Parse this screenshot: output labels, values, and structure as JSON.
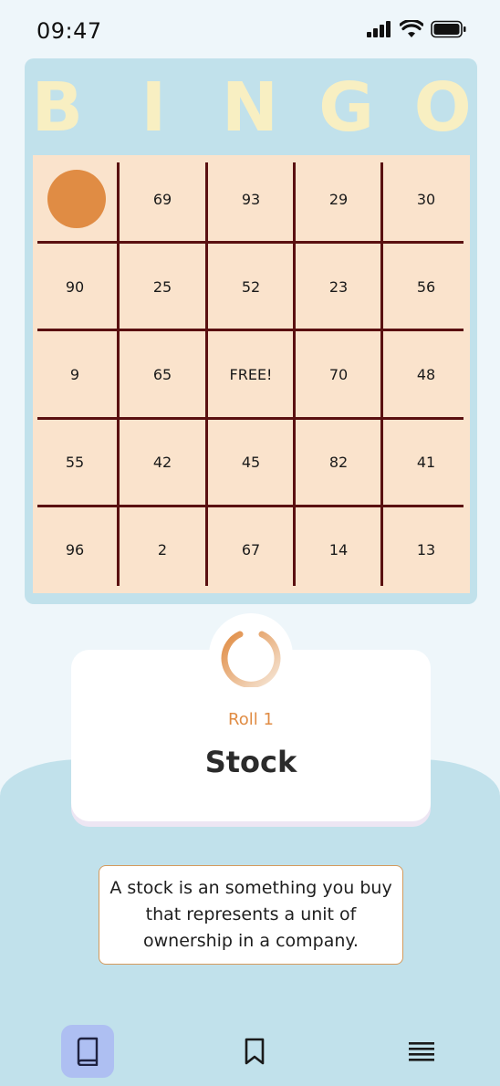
{
  "status_bar": {
    "time": "09:47"
  },
  "bingo": {
    "letters": [
      "B",
      "I",
      "N",
      "G",
      "O"
    ],
    "cells": [
      [
        "",
        "69",
        "93",
        "29",
        "30"
      ],
      [
        "90",
        "25",
        "52",
        "23",
        "56"
      ],
      [
        "9",
        "65",
        "FREE!",
        "70",
        "48"
      ],
      [
        "55",
        "42",
        "45",
        "82",
        "41"
      ],
      [
        "96",
        "2",
        "67",
        "14",
        "13"
      ]
    ],
    "marked_cell": "row 1, column 1"
  },
  "roll": {
    "label": "Roll 1",
    "word": "Stock"
  },
  "definition": "A stock is an something you buy that represents a unit of ownership in a company.",
  "bottom_nav": {
    "items": [
      {
        "icon": "book-icon",
        "active": true
      },
      {
        "icon": "bookmark-icon",
        "active": false
      },
      {
        "icon": "menu-icon",
        "active": false
      }
    ]
  },
  "colors": {
    "accent": "#e08c44",
    "card_frame": "#c1e1eb",
    "grid_bg": "#fae3cc",
    "grid_lines": "#5a1010",
    "letters": "#f8efc2",
    "nav_active": "#aebff2"
  }
}
